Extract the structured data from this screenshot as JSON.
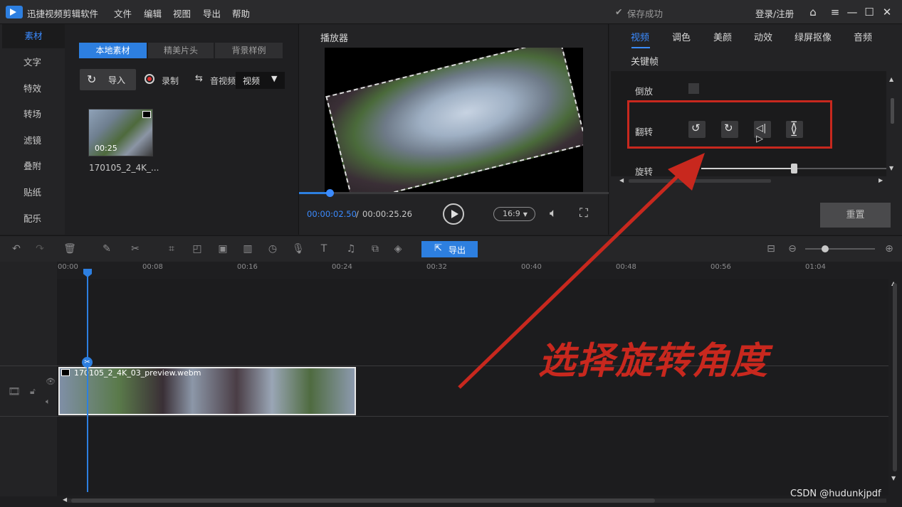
{
  "titlebar": {
    "app_name": "迅捷视频剪辑软件",
    "menu": [
      "文件",
      "编辑",
      "视图",
      "导出",
      "帮助"
    ],
    "save_status": "保存成功",
    "login": "登录/注册"
  },
  "left_tabs": [
    "素材",
    "文字",
    "特效",
    "转场",
    "滤镜",
    "叠附",
    "贴纸",
    "配乐"
  ],
  "media": {
    "subtabs": [
      "本地素材",
      "精美片头",
      "背景样例"
    ],
    "import_label": "导入",
    "record_label": "录制",
    "audio_video_label": "音视频",
    "type_select": "视频",
    "thumb_duration": "00:25",
    "thumb_name": "170105_2_4K_..."
  },
  "player": {
    "title": "播放器",
    "current_time": "00:00:02.50",
    "separator": "/",
    "total_time": "00:00:25.26",
    "ratio": "16:9",
    "progress": 0.099
  },
  "right_panel": {
    "tabs": [
      "视频",
      "调色",
      "美颜",
      "动效",
      "绿屏抠像",
      "音频",
      "关键帧"
    ],
    "reverse_label": "倒放",
    "flip_label": "翻转",
    "rotate_label": "旋转",
    "rotate_value": 0.5,
    "reset_label": "重置"
  },
  "toolbar": {
    "export_label": "导出",
    "zoom_level": 0.45
  },
  "timeline": {
    "ruler_labels": [
      "00:00",
      "00:08",
      "00:16",
      "00:24",
      "00:32",
      "00:40",
      "00:48",
      "00:56",
      "01:04"
    ],
    "clip_name": "170105_2_4K_03_preview.webm"
  },
  "annotation": "选择旋转角度",
  "watermark": "CSDN @hudunkjpdf",
  "colors": {
    "accent": "#2d7fe0",
    "annotation": "#c8281e",
    "panel": "#232325"
  }
}
